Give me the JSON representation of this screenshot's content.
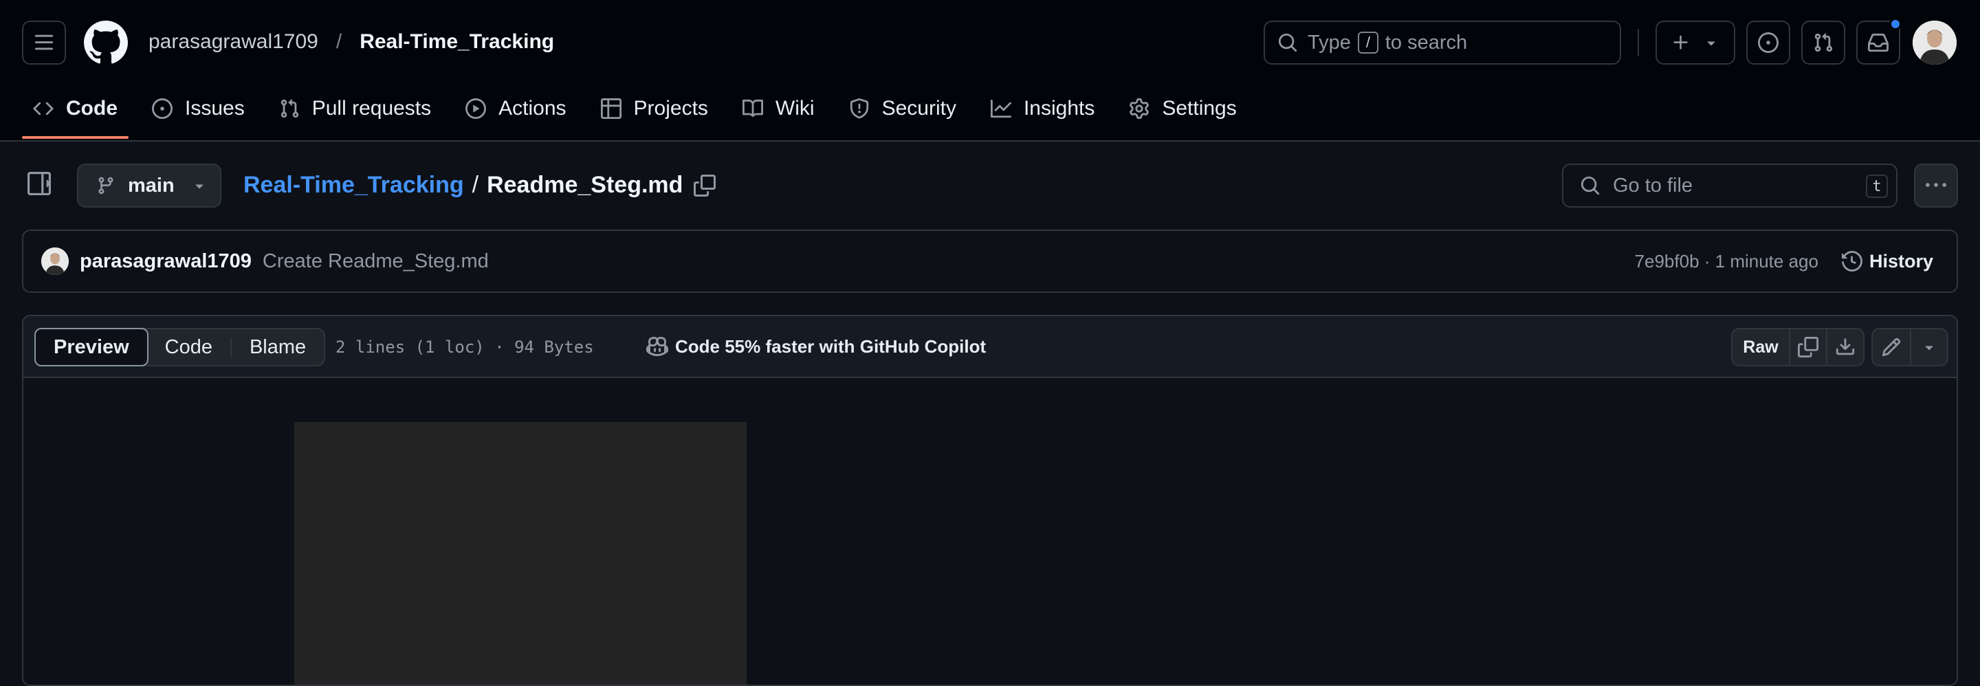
{
  "header": {
    "owner": "parasagrawal1709",
    "separator": "/",
    "repo": "Real-Time_Tracking",
    "search": {
      "prefix": "Type",
      "key": "/",
      "suffix": "to search"
    },
    "notification_color": "#2f81f7"
  },
  "nav": {
    "tabs": [
      {
        "label": "Code",
        "icon": "code-icon",
        "active": true
      },
      {
        "label": "Issues",
        "icon": "issue-opened-icon"
      },
      {
        "label": "Pull requests",
        "icon": "git-pull-request-icon"
      },
      {
        "label": "Actions",
        "icon": "play-icon"
      },
      {
        "label": "Projects",
        "icon": "table-icon"
      },
      {
        "label": "Wiki",
        "icon": "book-icon"
      },
      {
        "label": "Security",
        "icon": "shield-icon"
      },
      {
        "label": "Insights",
        "icon": "graph-icon"
      },
      {
        "label": "Settings",
        "icon": "gear-icon"
      }
    ],
    "active_color": "#f78166"
  },
  "file_header": {
    "branch": "main",
    "breadcrumb_repo": "Real-Time_Tracking",
    "breadcrumb_sep": "/",
    "filename": "Readme_Steg.md",
    "go_to_file": "Go to file",
    "go_to_file_key": "t"
  },
  "commit": {
    "author": "parasagrawal1709",
    "message": "Create Readme_Steg.md",
    "meta": "7e9bf0b · 1 minute ago",
    "history_label": "History"
  },
  "file": {
    "modes": [
      "Preview",
      "Code",
      "Blame"
    ],
    "active_mode": "Preview",
    "meta": "2 lines (1 loc) · 94 Bytes",
    "copilot": "Code 55% faster with GitHub Copilot",
    "raw_label": "Raw"
  },
  "colors": {
    "link": "#4493f8",
    "background": "#0d1117",
    "header_bg": "#010409",
    "border": "#30363d"
  }
}
